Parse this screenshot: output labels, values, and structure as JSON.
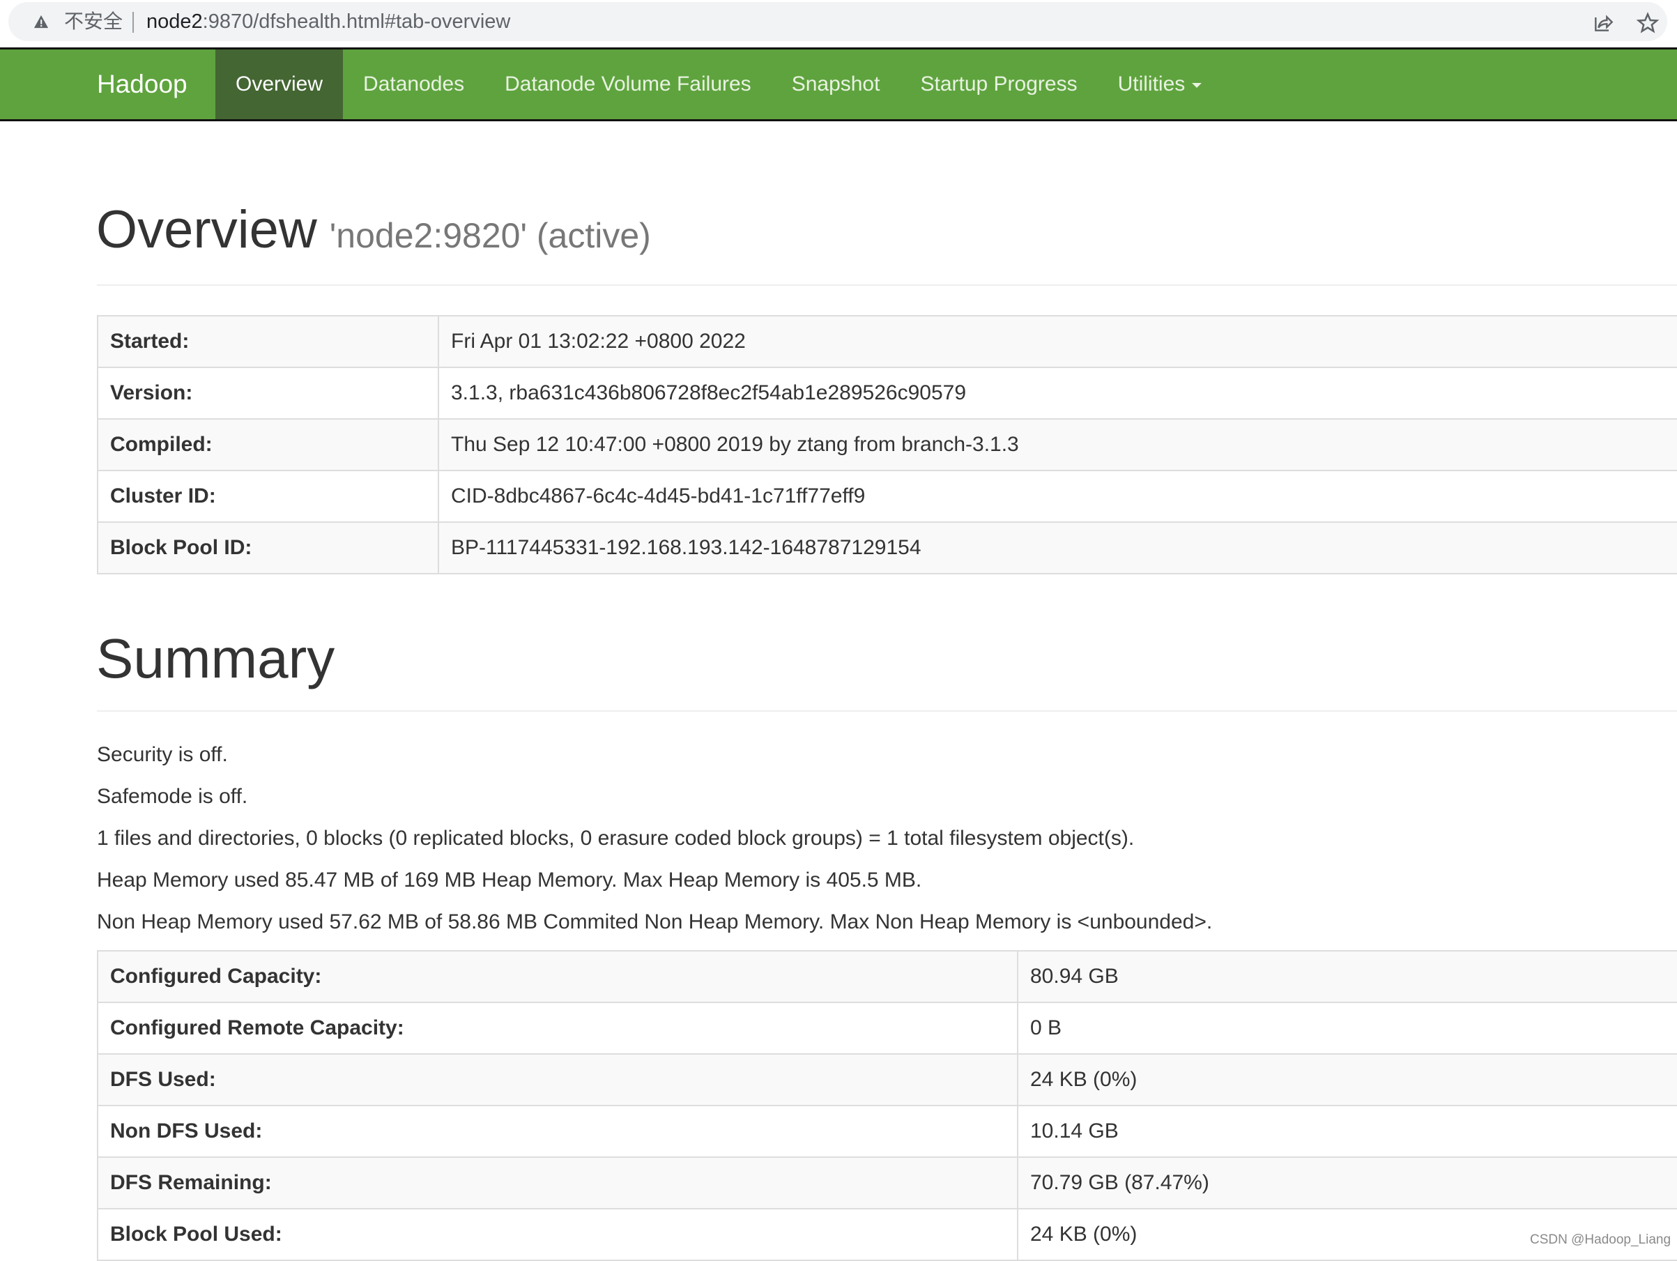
{
  "browser": {
    "security_label": "不安全",
    "url_host": "node2",
    "url_rest": ":9870/dfshealth.html#tab-overview",
    "icons": [
      "warning-icon",
      "share-icon",
      "star-icon"
    ]
  },
  "navbar": {
    "brand": "Hadoop",
    "items": [
      {
        "label": "Overview",
        "active": true
      },
      {
        "label": "Datanodes",
        "active": false
      },
      {
        "label": "Datanode Volume Failures",
        "active": false
      },
      {
        "label": "Snapshot",
        "active": false
      },
      {
        "label": "Startup Progress",
        "active": false
      },
      {
        "label": "Utilities",
        "active": false,
        "dropdown": true
      }
    ],
    "colors": {
      "background": "#5fa33e",
      "active": "#446633"
    }
  },
  "overview": {
    "title": "Overview",
    "subtitle": "'node2:9820' (active)",
    "rows": [
      {
        "label": "Started:",
        "value": "Fri Apr 01 13:02:22 +0800 2022"
      },
      {
        "label": "Version:",
        "value": "3.1.3, rba631c436b806728f8ec2f54ab1e289526c90579"
      },
      {
        "label": "Compiled:",
        "value": "Thu Sep 12 10:47:00 +0800 2019 by ztang from branch-3.1.3"
      },
      {
        "label": "Cluster ID:",
        "value": "CID-8dbc4867-6c4c-4d45-bd41-1c71ff77eff9"
      },
      {
        "label": "Block Pool ID:",
        "value": "BP-1117445331-192.168.193.142-1648787129154"
      }
    ]
  },
  "summary": {
    "title": "Summary",
    "lines": [
      "Security is off.",
      "Safemode is off.",
      "1 files and directories, 0 blocks (0 replicated blocks, 0 erasure coded block groups) = 1 total filesystem object(s).",
      "Heap Memory used 85.47 MB of 169 MB Heap Memory. Max Heap Memory is 405.5 MB.",
      "Non Heap Memory used 57.62 MB of 58.86 MB Commited Non Heap Memory. Max Non Heap Memory is <unbounded>."
    ],
    "rows": [
      {
        "label": "Configured Capacity:",
        "value": "80.94 GB"
      },
      {
        "label": "Configured Remote Capacity:",
        "value": "0 B"
      },
      {
        "label": "DFS Used:",
        "value": "24 KB (0%)"
      },
      {
        "label": "Non DFS Used:",
        "value": "10.14 GB"
      },
      {
        "label": "DFS Remaining:",
        "value": "70.79 GB (87.47%)"
      },
      {
        "label": "Block Pool Used:",
        "value": "24 KB (0%)"
      }
    ]
  },
  "watermark": "CSDN @Hadoop_Liang"
}
